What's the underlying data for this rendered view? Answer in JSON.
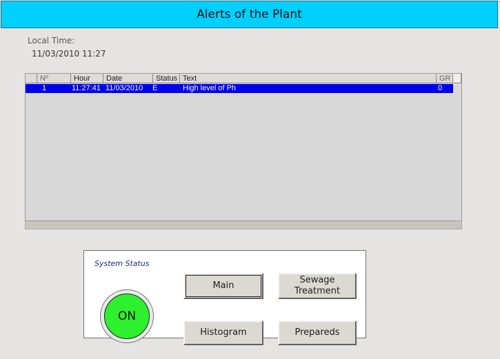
{
  "header": {
    "title": "Alerts of the Plant"
  },
  "local_time": {
    "label": "Local Time:",
    "value": "11/03/2010 11:27"
  },
  "alarm_table": {
    "columns": {
      "no": "Nº",
      "hour": "Hour",
      "date": "Date",
      "status": "Status",
      "text": "Text",
      "gr": "GR"
    },
    "rows": [
      {
        "no": "1",
        "hour": "11:27:41",
        "date": "11/03/2010",
        "status": "E",
        "text": "High level of Ph",
        "gr": "0"
      }
    ],
    "selected_row_color": "#0000f0"
  },
  "system_status": {
    "title": "System Status",
    "indicator": {
      "label": "ON",
      "color": "#2ef02e"
    },
    "buttons": {
      "main": "Main",
      "sewage_line1": "Sewage",
      "sewage_line2": "Treatment",
      "histogram": "Histogram",
      "prepareds": "Prepareds"
    }
  },
  "colors": {
    "title_bar": "#00d0ff",
    "background": "#e6e4e2"
  }
}
